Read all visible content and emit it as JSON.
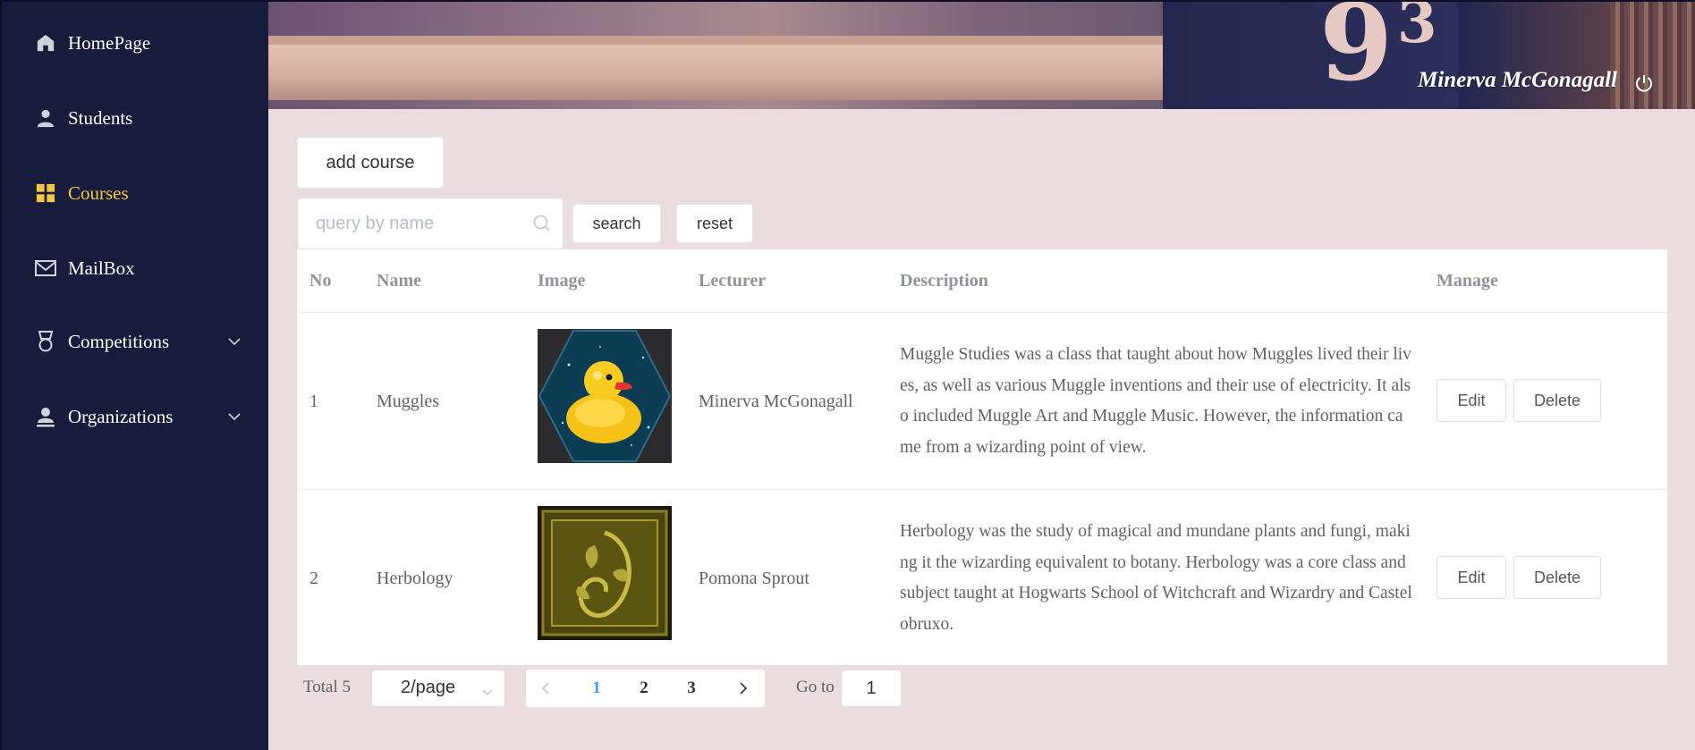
{
  "sidebar": {
    "items": [
      {
        "label": "HomePage",
        "icon": "home-icon"
      },
      {
        "label": "Students",
        "icon": "user-icon"
      },
      {
        "label": "Courses",
        "icon": "grid-icon",
        "active": true
      },
      {
        "label": "MailBox",
        "icon": "mail-icon"
      },
      {
        "label": "Competitions",
        "icon": "medal-icon",
        "expandable": true
      },
      {
        "label": "Organizations",
        "icon": "org-icon",
        "expandable": true
      }
    ],
    "accent_color": "#f5c842",
    "background": "#171c3c"
  },
  "header": {
    "user_name": "Minerva McGonagall",
    "banner_sign": "9",
    "banner_sign_sup": "3",
    "logout_icon": "power-icon"
  },
  "toolbar": {
    "add_label": "add course",
    "search_placeholder": "query by name",
    "search_value": "",
    "search_label": "search",
    "reset_label": "reset"
  },
  "table": {
    "headers": {
      "no": "No",
      "name": "Name",
      "image": "Image",
      "lecturer": "Lecturer",
      "description": "Description",
      "manage": "Manage"
    },
    "rows": [
      {
        "no": "1",
        "name": "Muggles",
        "image_icon": "rubber-duck-image",
        "lecturer": "Minerva McGonagall",
        "description": "Muggle Studies was a class that taught about how Muggles lived their lives, as well as various Muggle inventions and their use of electricity. It also included Muggle Art and Muggle Music. However, the information came from a wizarding point of view.",
        "edit_label": "Edit",
        "delete_label": "Delete"
      },
      {
        "no": "2",
        "name": "Herbology",
        "image_icon": "herbology-book-image",
        "lecturer": "Pomona Sprout",
        "description": "Herbology was the study of magical and mundane plants and fungi, making it the wizarding equivalent to botany. Herbology was a core class and subject taught at Hogwarts School of Witchcraft and Wizardry and Castelobruxo.",
        "edit_label": "Edit",
        "delete_label": "Delete"
      }
    ]
  },
  "pagination": {
    "total_label": "Total 5",
    "page_size_label": "2/page",
    "pages": [
      "1",
      "2",
      "3"
    ],
    "current_page": "1",
    "goto_label": "Go to",
    "goto_value": "1",
    "active_color": "#409eff"
  }
}
